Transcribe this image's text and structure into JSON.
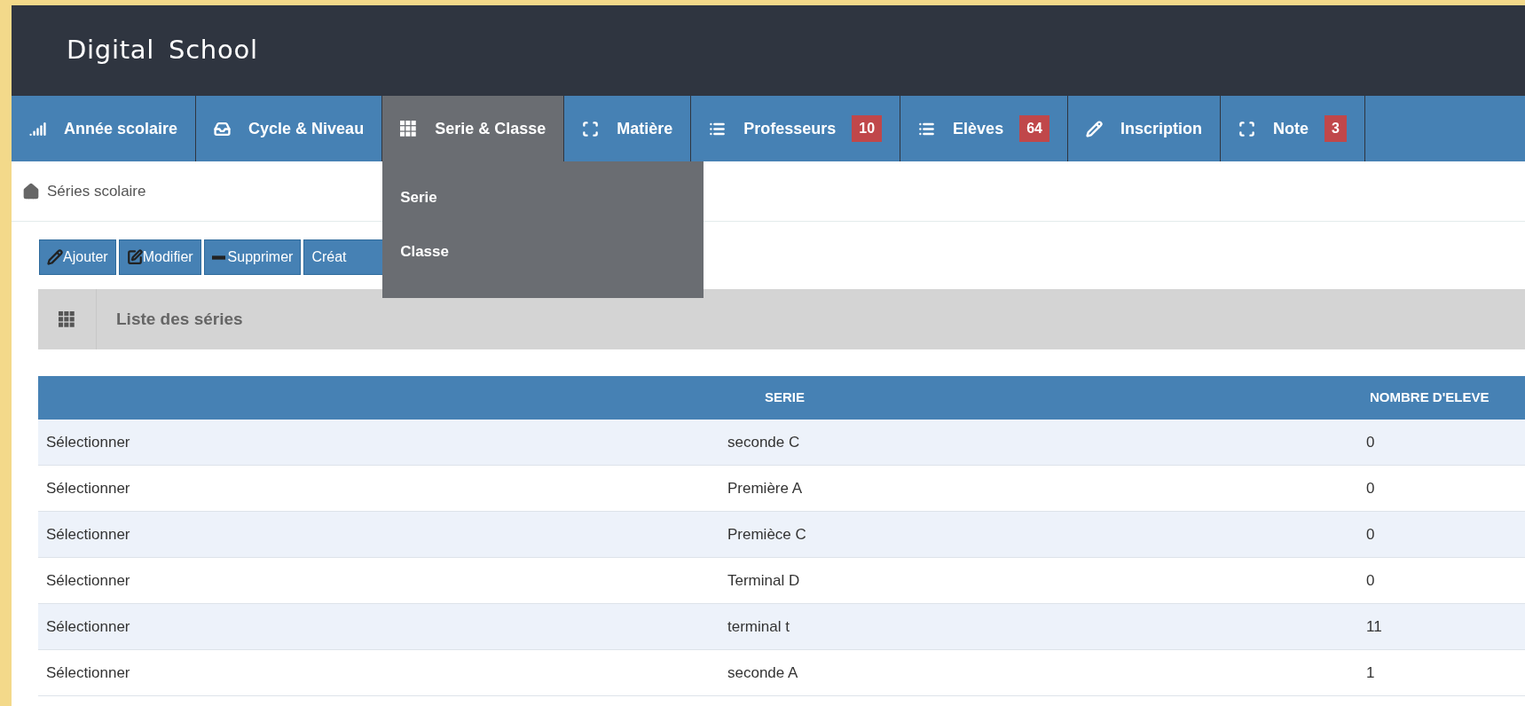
{
  "app": {
    "title": "Digital School"
  },
  "nav": {
    "tabs": [
      {
        "label": "Année scolaire",
        "selected": false
      },
      {
        "label": "Cycle & Niveau",
        "selected": false
      },
      {
        "label": "Serie & Classe",
        "selected": true,
        "expanded": true,
        "menu": [
          "Serie",
          "Classe"
        ]
      },
      {
        "label": "Matière",
        "selected": false
      },
      {
        "label": "Professeurs",
        "badge": "10",
        "selected": false
      },
      {
        "label": "Elèves",
        "badge": "64",
        "selected": false
      },
      {
        "label": "Inscription",
        "selected": false
      },
      {
        "label": "Note",
        "badge": "3",
        "selected": false
      }
    ]
  },
  "breadcrumb": "Séries scolaire",
  "toolbar": [
    {
      "label": "Ajouter"
    },
    {
      "label": "Modifier"
    },
    {
      "label": "Supprimer"
    },
    {
      "label": "Créat"
    }
  ],
  "panel": {
    "title": "Liste des séries"
  },
  "table": {
    "columns": [
      "SERIE",
      "NOMBRE D'ELEVE"
    ],
    "rows": [
      {
        "action": "Sélectionner",
        "serie": "seconde C",
        "count": "0"
      },
      {
        "action": "Sélectionner",
        "serie": "Première A",
        "count": "0"
      },
      {
        "action": "Sélectionner",
        "serie": "Premièce C",
        "count": "0"
      },
      {
        "action": "Sélectionner",
        "serie": "Terminal D",
        "count": "0"
      },
      {
        "action": "Sélectionner",
        "serie": "terminal t",
        "count": "11"
      },
      {
        "action": "Sélectionner",
        "serie": "seconde A",
        "count": "1"
      }
    ]
  }
}
